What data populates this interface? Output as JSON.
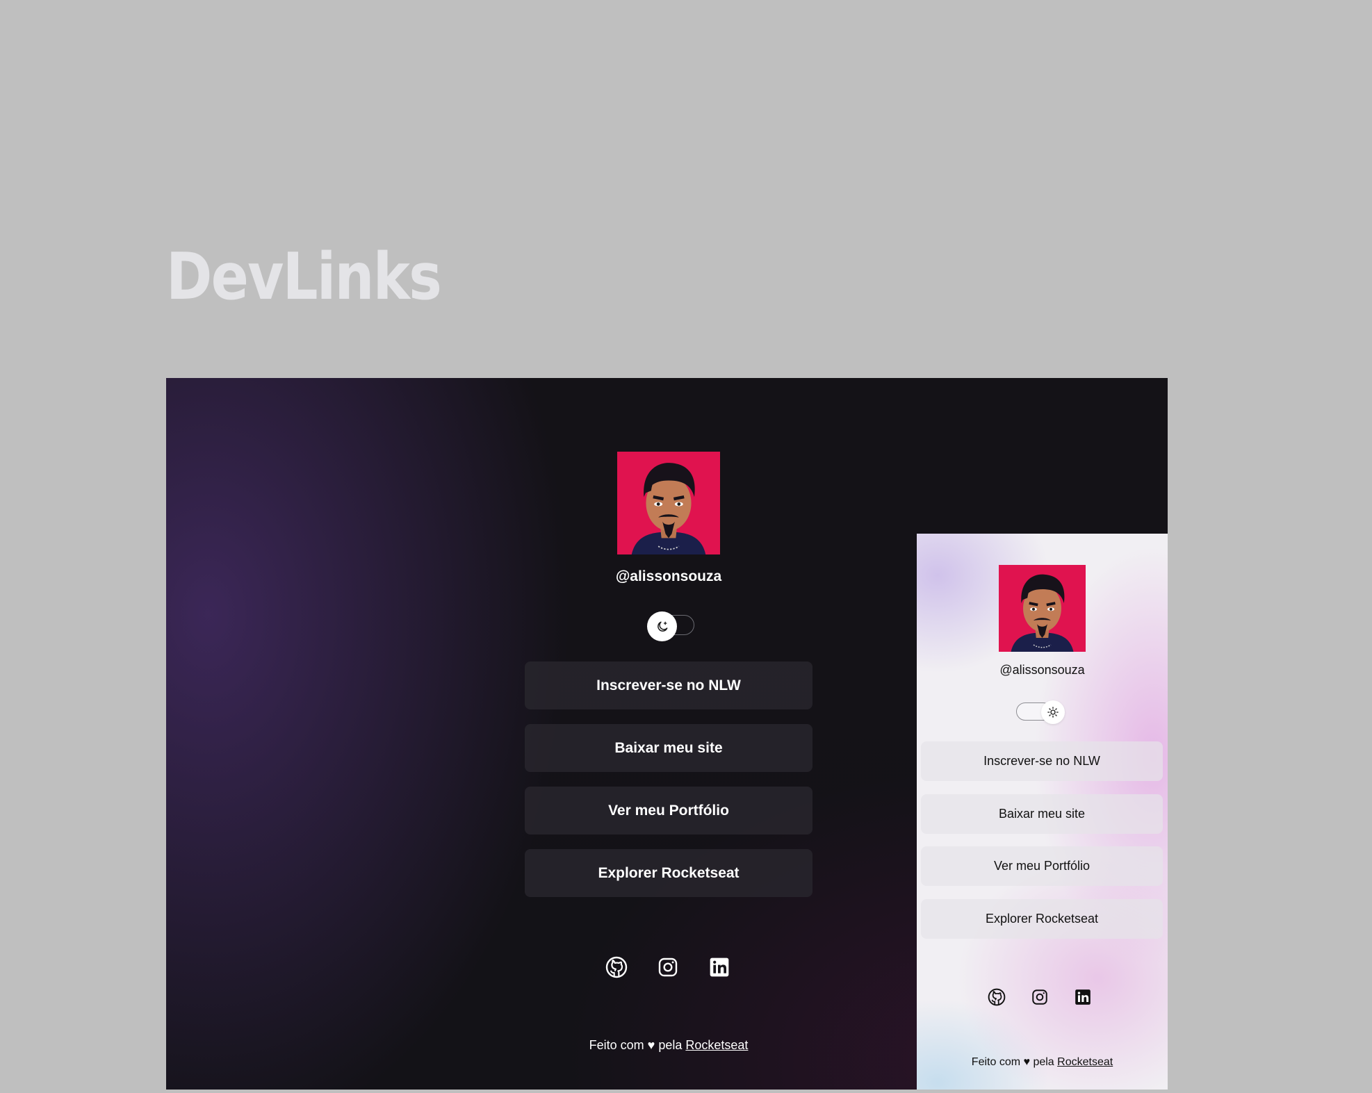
{
  "page": {
    "title": "DevLinks"
  },
  "profile": {
    "username": "@alissonsouza",
    "avatar": "avatar-illustration",
    "avatar_bg": "#e0134f"
  },
  "links": [
    {
      "label": "Inscrever-se no NLW"
    },
    {
      "label": "Baixar meu site"
    },
    {
      "label": "Ver meu Portfólio"
    },
    {
      "label": "Explorer Rocketseat"
    }
  ],
  "dark_mode": {
    "switch_icon": "moon-icon",
    "background": "#131217",
    "button_bg": "#28262d",
    "text_color": "#ffffff"
  },
  "light_mode": {
    "switch_icon": "sun-icon",
    "background": "#f1eff3",
    "button_bg": "#e6e4e8",
    "text_color": "#111111"
  },
  "socials": [
    {
      "icon": "github-icon"
    },
    {
      "icon": "instagram-icon"
    },
    {
      "icon": "linkedin-icon"
    }
  ],
  "footer": {
    "text_prefix": "Feito com",
    "heart": "♥",
    "text_middle": "pela",
    "link_label": "Rocketseat"
  }
}
